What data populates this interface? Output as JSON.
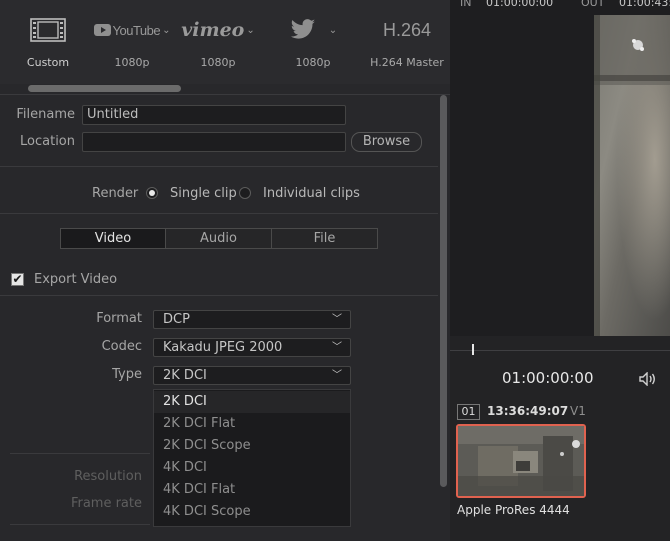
{
  "presets": [
    {
      "name": "Custom",
      "label": "Custom",
      "icon": "film-icon"
    },
    {
      "name": "YouTube",
      "label": "1080p",
      "icon": "youtube-icon",
      "logo": "YouTube"
    },
    {
      "name": "Vimeo",
      "label": "1080p",
      "icon": "vimeo-icon",
      "logo": "vimeo"
    },
    {
      "name": "Twitter",
      "label": "1080p",
      "icon": "twitter-icon"
    },
    {
      "name": "H.264",
      "label": "H.264 Master",
      "icon": "h264-icon",
      "logo": "H.264"
    }
  ],
  "file": {
    "filename_label": "Filename",
    "filename_value": "Untitled",
    "location_label": "Location",
    "location_value": "",
    "browse_label": "Browse"
  },
  "render": {
    "label": "Render",
    "single_clip": "Single clip",
    "individual_clips": "Individual clips",
    "selected": "single_clip"
  },
  "tabs": [
    "Video",
    "Audio",
    "File"
  ],
  "active_tab": "Video",
  "export_video": {
    "label": "Export Video",
    "checked": true
  },
  "format": {
    "label": "Format",
    "value": "DCP"
  },
  "codec": {
    "label": "Codec",
    "value": "Kakadu JPEG 2000"
  },
  "type": {
    "label": "Type",
    "value": "2K DCI",
    "options": [
      "2K DCI",
      "2K DCI Flat",
      "2K DCI Scope",
      "4K DCI",
      "4K DCI Flat",
      "4K DCI Scope"
    ]
  },
  "dim_labels": {
    "resolution": "Resolution",
    "frame_rate": "Frame rate"
  },
  "viewer": {
    "in_label": "IN",
    "in_tc": "01:00:00:00",
    "out_label": "OUT",
    "out_tc": "01:00:43:",
    "timecode": "01:00:00:00",
    "volume_icon": "speaker-icon"
  },
  "clip": {
    "index": "01",
    "timecode": "13:36:49:07",
    "track": "V1",
    "codec": "Apple ProRes 4444"
  },
  "colors": {
    "accent_border": "#e0624f",
    "panel": "#28282b",
    "text": "#bdbdbd"
  }
}
